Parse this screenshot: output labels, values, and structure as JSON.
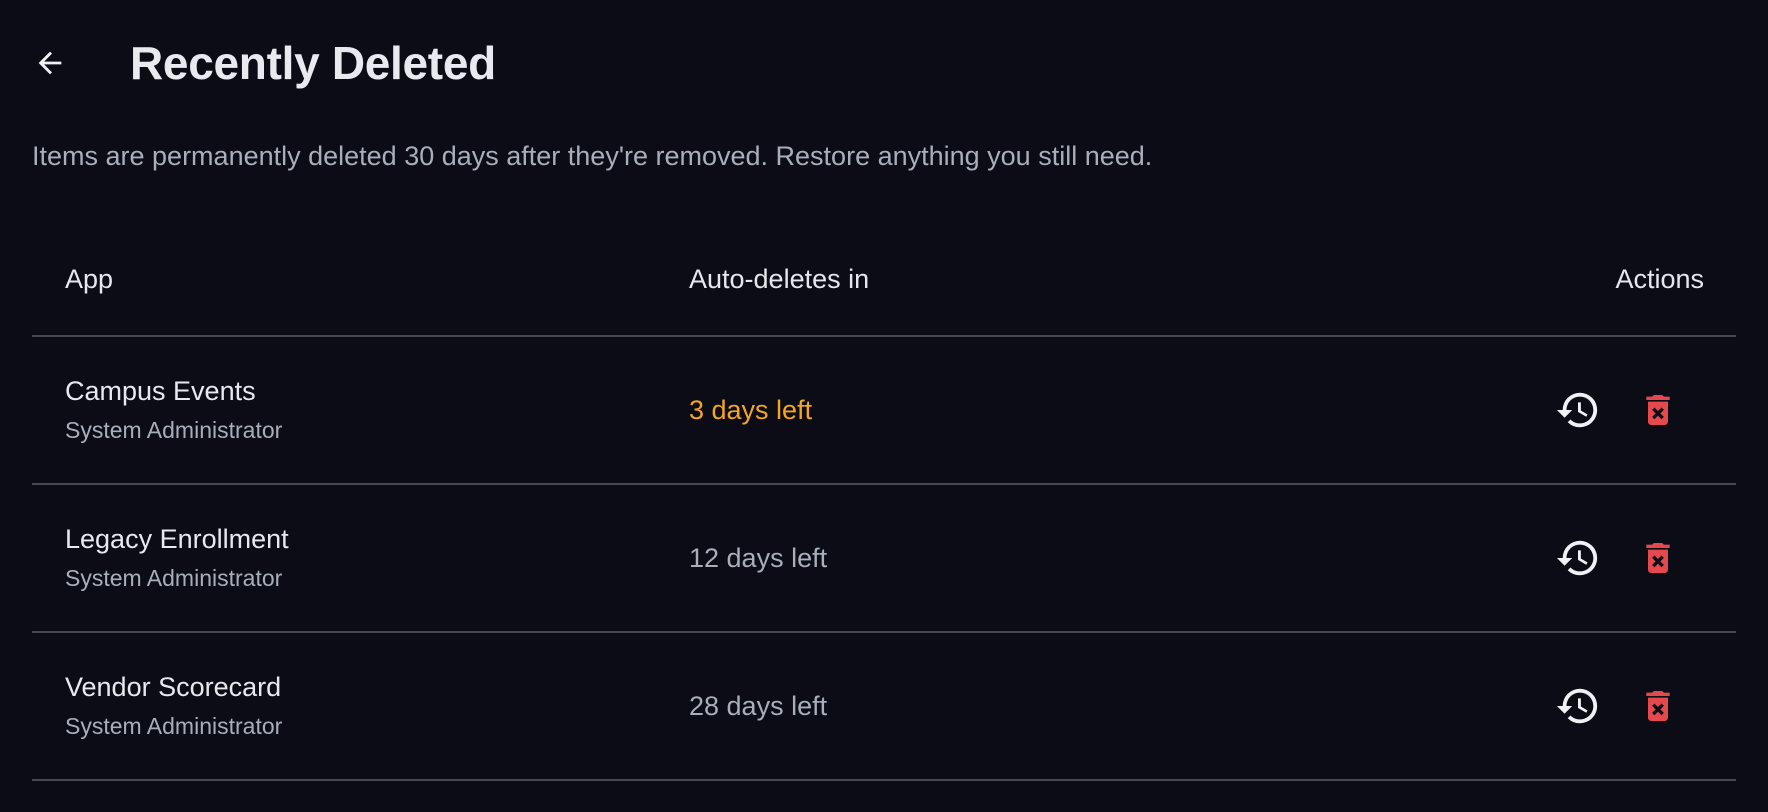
{
  "header": {
    "title": "Recently Deleted",
    "back_icon": "arrow-left-icon"
  },
  "description": "Items are permanently deleted 30 days after they're removed. Restore anything you still need.",
  "table": {
    "columns": [
      "App",
      "Auto-deletes in",
      "Actions"
    ],
    "rows": [
      {
        "name": "Campus Events",
        "owner": "System Administrator",
        "days_left": "3 days left",
        "urgent": true
      },
      {
        "name": "Legacy Enrollment",
        "owner": "System Administrator",
        "days_left": "12 days left",
        "urgent": false
      },
      {
        "name": "Vendor Scorecard",
        "owner": "System Administrator",
        "days_left": "28 days left",
        "urgent": false
      }
    ]
  },
  "icons": {
    "restore": "restore-history-icon",
    "delete": "delete-forever-icon"
  },
  "colors": {
    "background": "#0b0c15",
    "urgent": "#f5a524",
    "danger": "#e5484d",
    "muted": "#a9aebb",
    "divider": "#454852"
  }
}
